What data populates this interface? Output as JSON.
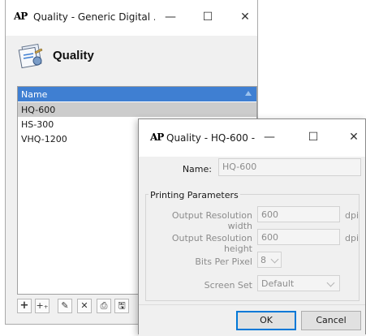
{
  "main_window": {
    "logo": "AP",
    "title": "Quality - Generic Digital ...",
    "controls": {
      "minimize": "—",
      "maximize": "☐",
      "close": "✕"
    },
    "header_title": "Quality",
    "list": {
      "column_header": "Name",
      "rows": [
        "HQ-600",
        "HS-300",
        "VHQ-1200"
      ],
      "selected_row": "HQ-600"
    },
    "toolbar": {
      "add": "+",
      "add_multiple": "+₊",
      "edit": "✎",
      "delete": "✕",
      "import": "⎙",
      "save": "🖫"
    }
  },
  "dialog": {
    "logo": "AP",
    "title": "Quality - HQ-600 - ...",
    "controls": {
      "minimize": "—",
      "maximize": "☐",
      "close": "✕"
    },
    "name_label": "Name:",
    "name_value": "HQ-600",
    "group_title": "Printing Parameters",
    "fields": {
      "out_res_width_label": "Output Resolution width",
      "out_res_width_value": "600",
      "out_res_width_unit": "dpi",
      "out_res_height_label": "Output Resolution height",
      "out_res_height_value": "600",
      "out_res_height_unit": "dpi",
      "bits_per_pixel_label": "Bits Per Pixel",
      "bits_per_pixel_value": "8",
      "screen_set_label": "Screen Set",
      "screen_set_value": "Default"
    },
    "ok_label": "OK",
    "cancel_label": "Cancel"
  }
}
